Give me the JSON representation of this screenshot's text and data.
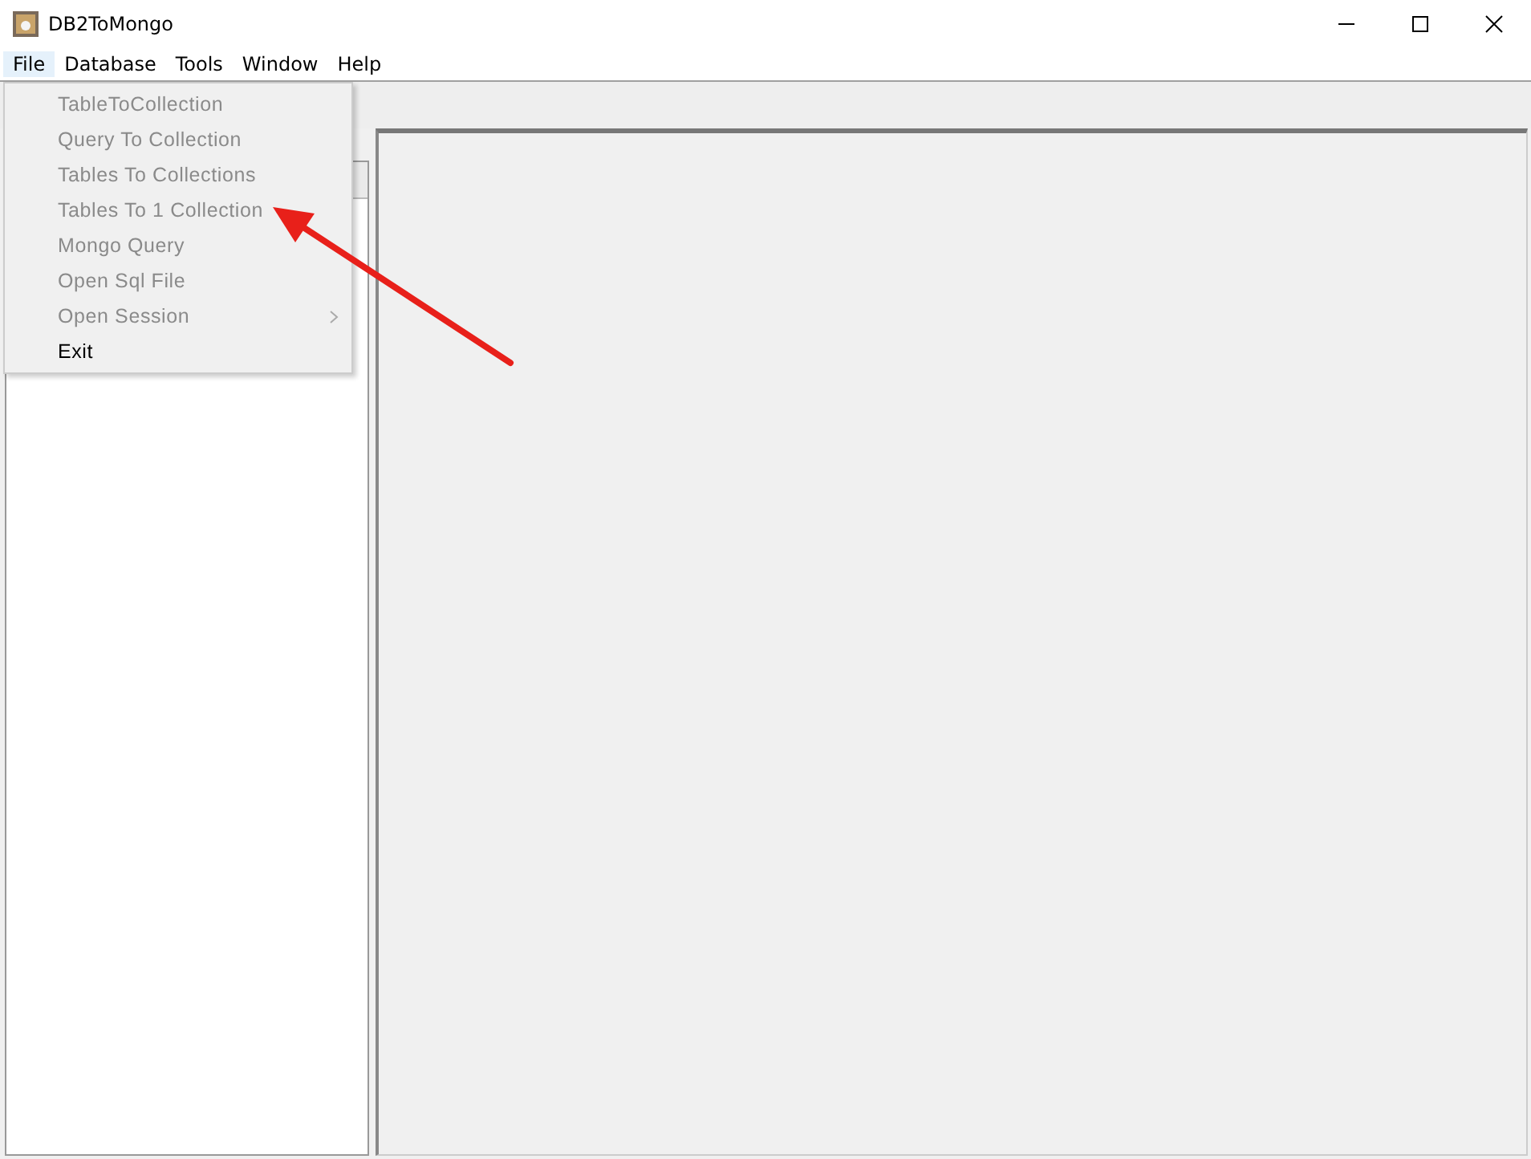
{
  "window": {
    "title": "DB2ToMongo"
  },
  "menu_bar": [
    {
      "label": "File",
      "open": true
    },
    {
      "label": "Database",
      "open": false
    },
    {
      "label": "Tools",
      "open": false
    },
    {
      "label": "Window",
      "open": false
    },
    {
      "label": "Help",
      "open": false
    }
  ],
  "file_menu": [
    {
      "label": "TableToCollection",
      "disabled": true,
      "submenu": false
    },
    {
      "label": "Query To Collection",
      "disabled": true,
      "submenu": false
    },
    {
      "label": "Tables To Collections",
      "disabled": true,
      "submenu": false
    },
    {
      "label": "Tables To 1 Collection",
      "disabled": true,
      "submenu": false
    },
    {
      "label": "Mongo Query",
      "disabled": true,
      "submenu": false
    },
    {
      "label": "Open Sql File",
      "disabled": true,
      "submenu": false
    },
    {
      "label": "Open Session",
      "disabled": true,
      "submenu": true
    },
    {
      "label": "Exit",
      "disabled": false,
      "submenu": false
    }
  ]
}
